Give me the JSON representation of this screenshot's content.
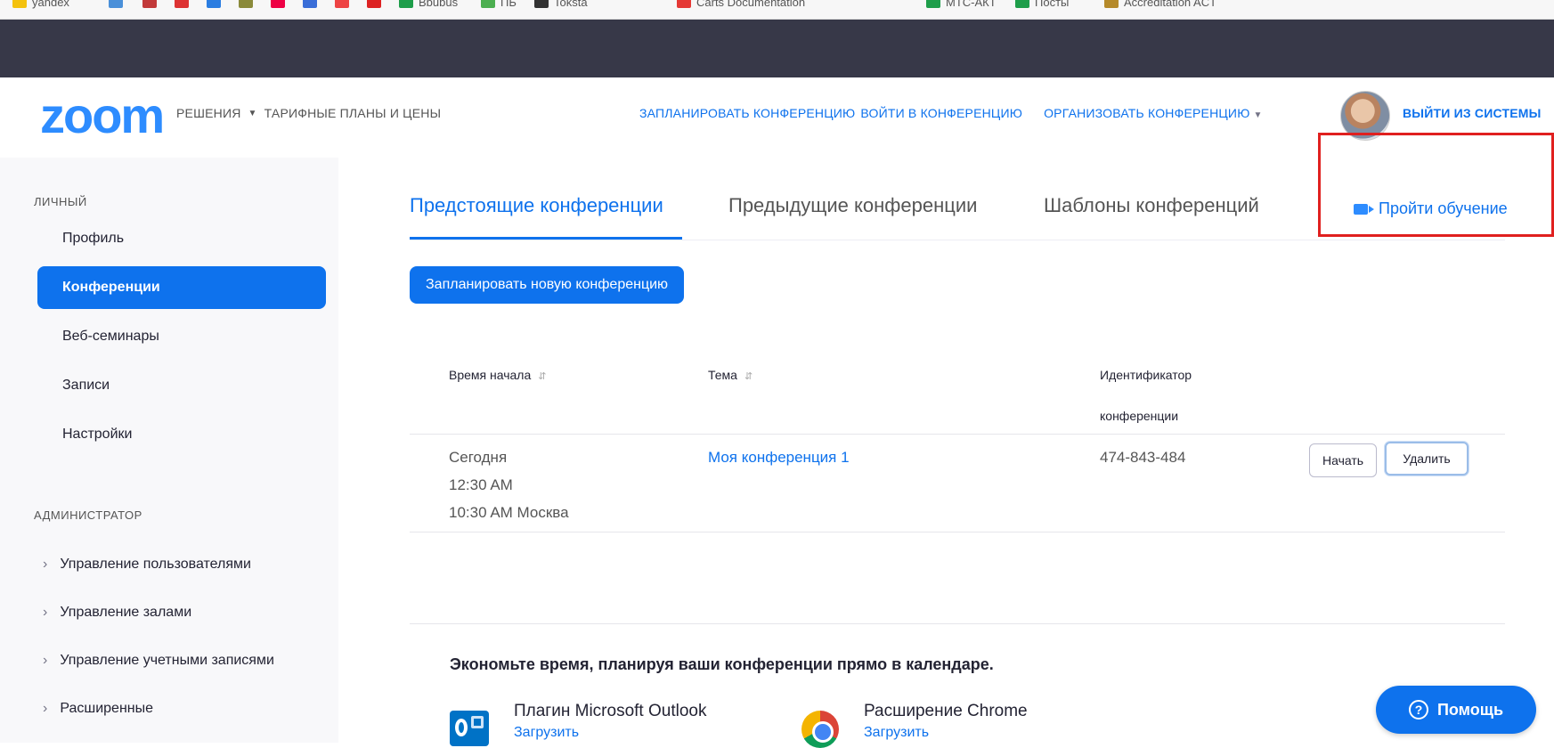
{
  "bookmarks": [
    {
      "label": "yandex",
      "color": "#f4c20d"
    },
    {
      "label": "",
      "color": "#4a90d9"
    },
    {
      "label": "",
      "color": "#c23a3a"
    },
    {
      "label": "",
      "color": "#d33"
    },
    {
      "label": "",
      "color": "#2a7de1"
    },
    {
      "label": "",
      "color": "#8a8a3a"
    },
    {
      "label": "",
      "color": "#e04"
    },
    {
      "label": "",
      "color": "#3a6ed8"
    },
    {
      "label": "",
      "color": "#e44"
    },
    {
      "label": "",
      "color": "#d22"
    },
    {
      "label": "Bbubus",
      "color": "#1e9e4a"
    },
    {
      "label": "ПБ",
      "color": "#4caf50"
    },
    {
      "label": "Toksta",
      "color": "#333"
    },
    {
      "label": "Carts Documentation",
      "color": "#e53935"
    },
    {
      "label": "MTC-АКТ",
      "color": "#1e9e4a"
    },
    {
      "label": "Посты",
      "color": "#1e9e4a"
    },
    {
      "label": "Accreditation ACT",
      "color": "#b58a2a"
    }
  ],
  "header": {
    "logo": "zoom",
    "solutions": "РЕШЕНИЯ",
    "plans": "ТАРИФНЫЕ ПЛАНЫ И ЦЕНЫ",
    "schedule": "ЗАПЛАНИРОВАТЬ КОНФЕРЕНЦИЮ",
    "join": "ВОЙТИ В КОНФЕРЕНЦИЮ",
    "host": "ОРГАНИЗОВАТЬ КОНФЕРЕНЦИЮ",
    "signout": "ВЫЙТИ ИЗ СИСТЕМЫ"
  },
  "sidebar": {
    "personal_title": "ЛИЧНЫЙ",
    "items": [
      {
        "label": "Профиль"
      },
      {
        "label": "Конференции"
      },
      {
        "label": "Веб-семинары"
      },
      {
        "label": "Записи"
      },
      {
        "label": "Настройки"
      }
    ],
    "admin_title": "АДМИНИСТРАТОР",
    "admin_items": [
      {
        "label": "Управление пользователями"
      },
      {
        "label": "Управление залами"
      },
      {
        "label": "Управление учетными записями"
      },
      {
        "label": "Расширенные"
      }
    ]
  },
  "tabs": [
    {
      "label": "Предстоящие конференции"
    },
    {
      "label": "Предыдущие конференции"
    },
    {
      "label": "Шаблоны конференций"
    }
  ],
  "training": "Пройти обучение",
  "schedule_button": "Запланировать новую конференцию",
  "table": {
    "headers": {
      "start": "Время начала",
      "topic": "Тема",
      "id_line1": "Идентификатор",
      "id_line2": "конференции"
    },
    "rows": [
      {
        "day": "Сегодня",
        "time": "12:30 AM",
        "time_local": "10:30 AM Москва",
        "topic": "Моя конференция 1",
        "id": "474-843-484",
        "start_label": "Начать",
        "delete_label": "Удалить"
      }
    ]
  },
  "promo": {
    "title": "Экономьте время, планируя ваши конференции прямо в календаре.",
    "outlook_name": "Плагин Microsoft Outlook",
    "outlook_link": "Загрузить",
    "chrome_name": "Расширение Chrome",
    "chrome_link": "Загрузить"
  },
  "help": "Помощь"
}
